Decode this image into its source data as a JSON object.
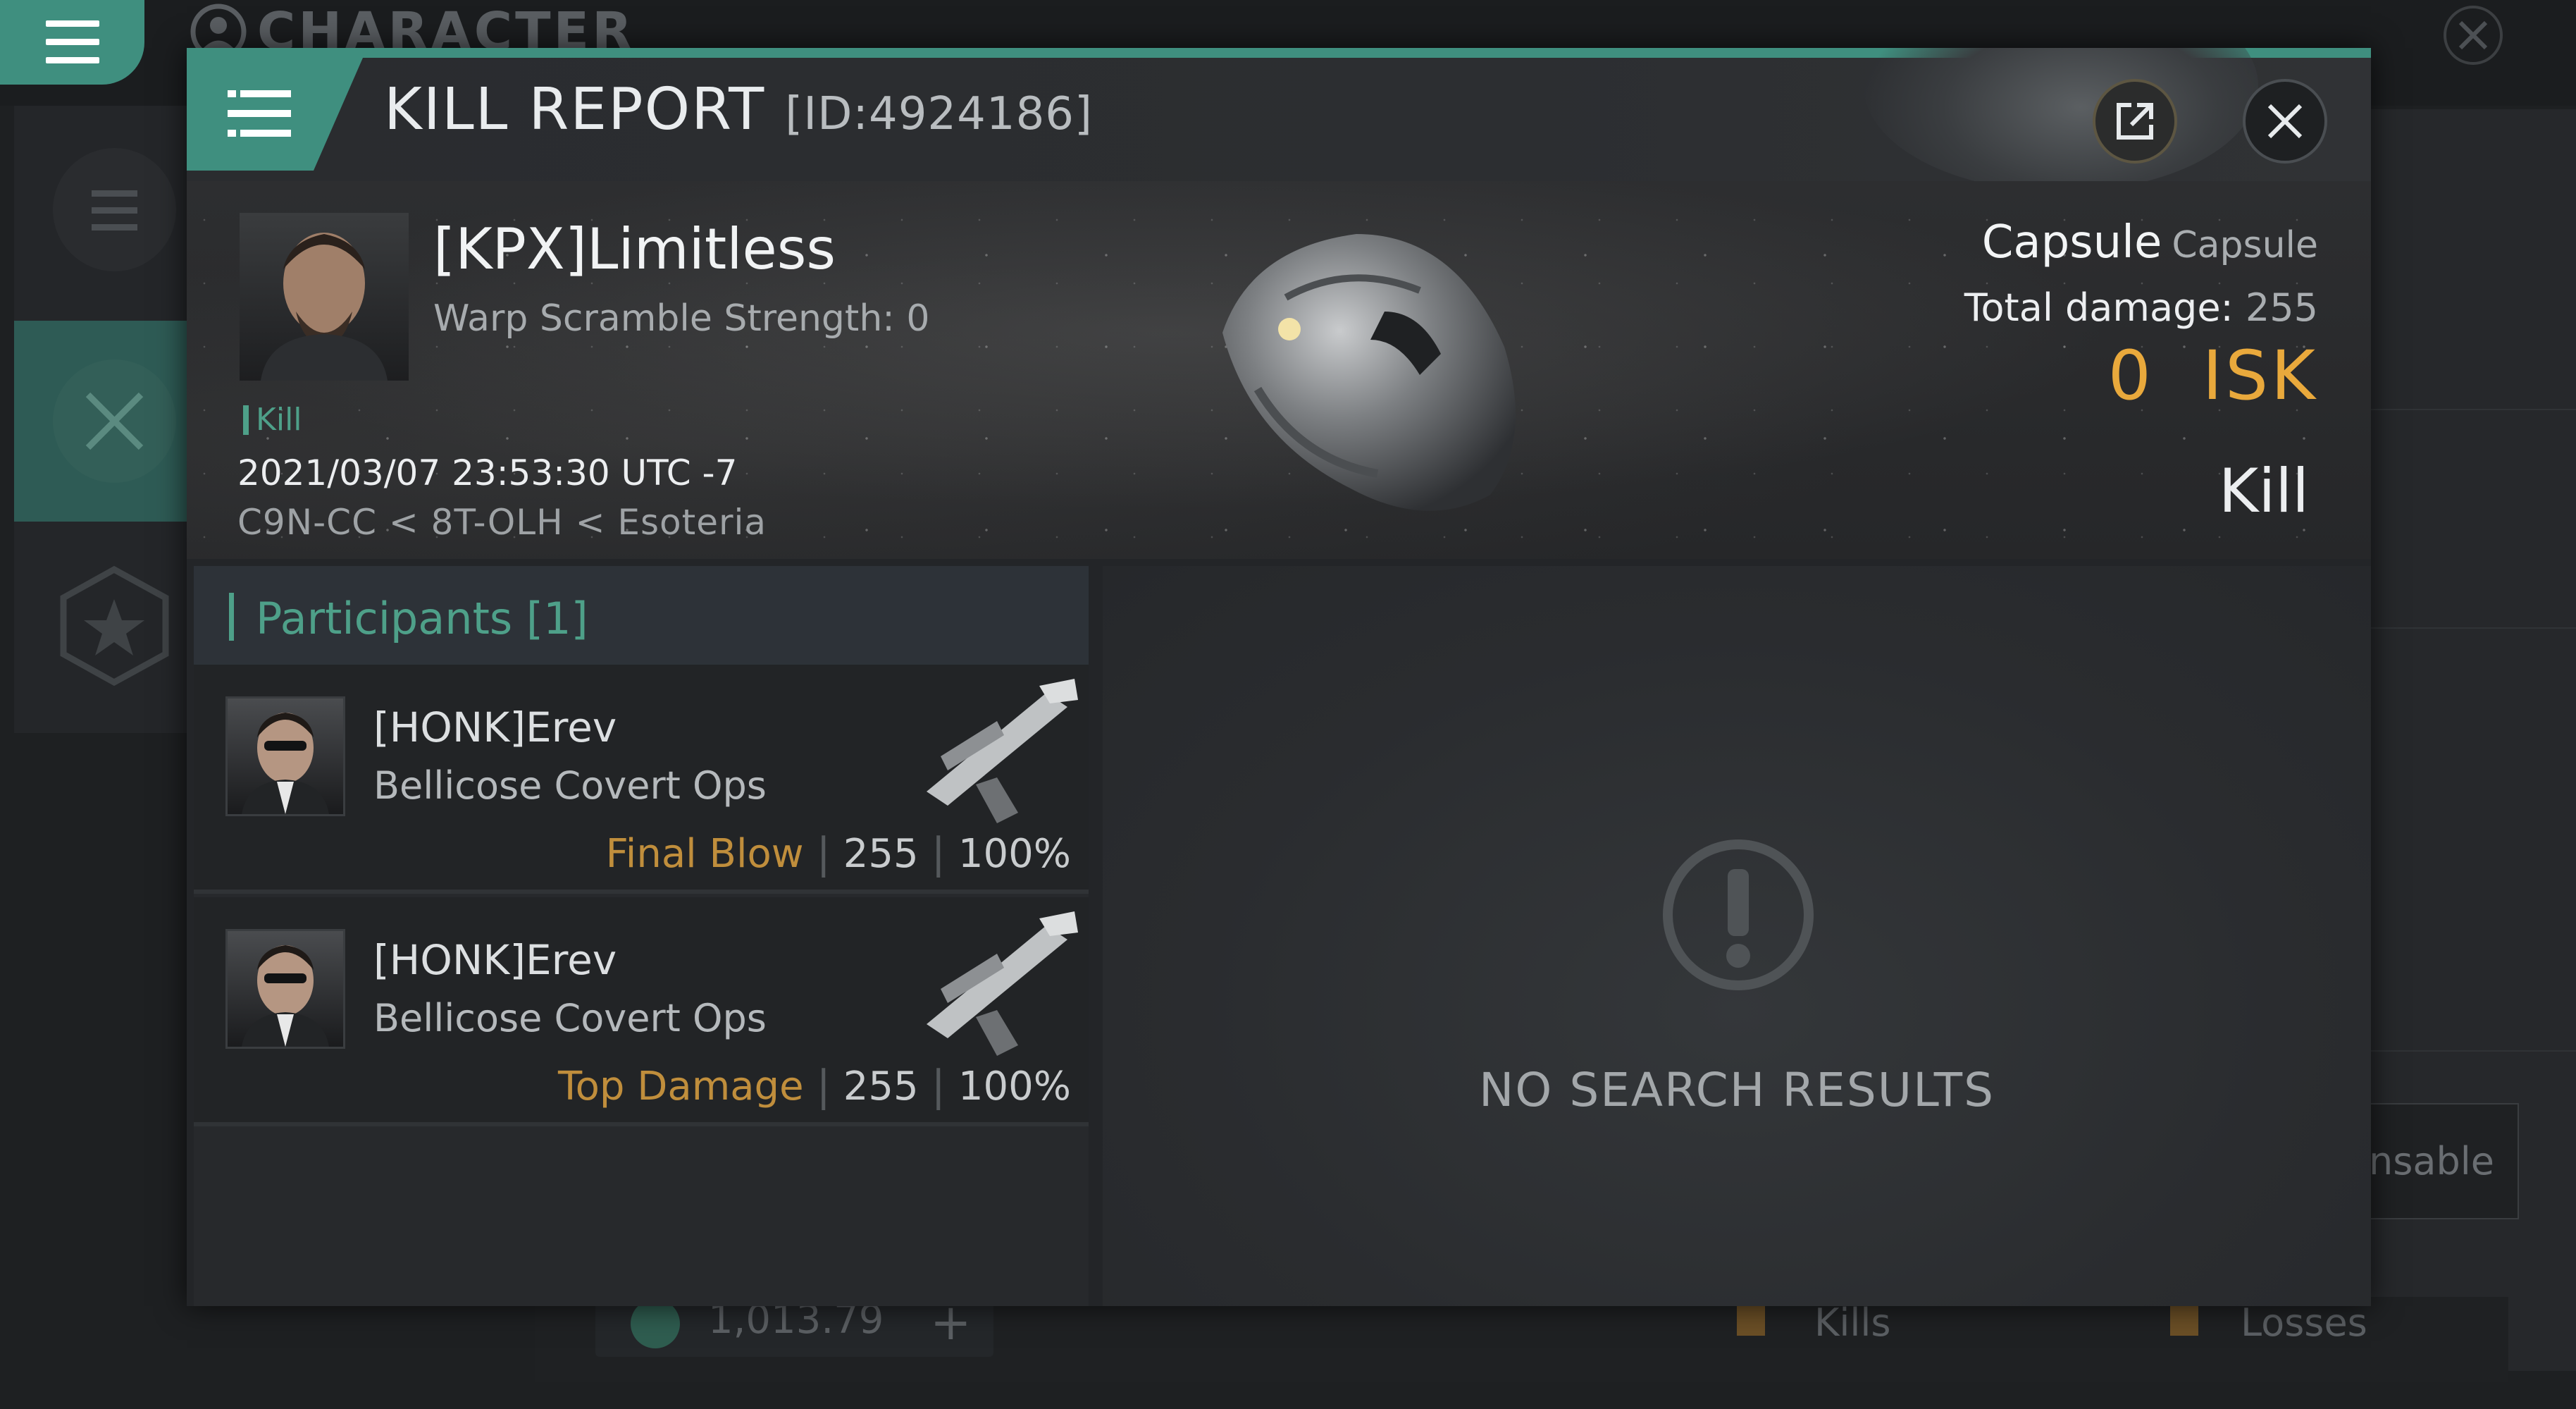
{
  "background": {
    "title": "CHARACTER",
    "collapsable_partial": "nsable",
    "security_value": "1,013.79",
    "legend": {
      "kills": "Kills",
      "losses": "Losses"
    },
    "icons": [
      "menu-icon",
      "character-icon",
      "close-icon",
      "list-icon",
      "crossed-swords-icon",
      "star-badge-icon",
      "plus-icon"
    ]
  },
  "header": {
    "title": "KILL REPORT",
    "id_text": "[ID:4924186]"
  },
  "victim": {
    "name": "[KPX]Limitless",
    "warp_scramble": "Warp Scramble Strength: 0",
    "tag": "Kill",
    "timestamp": "2021/03/07 23:53:30 UTC -7",
    "location": "C9N-CC < 8T-OLH < Esoteria",
    "ship_name": "Capsule",
    "ship_class": "Capsule",
    "total_damage_label": "Total damage:",
    "total_damage_value": "255",
    "isk": "0  ISK",
    "result": "Kill"
  },
  "participants": {
    "header": "Participants [1]",
    "rows": [
      {
        "name": "[HONK]Erev",
        "ship": "Bellicose Covert Ops",
        "label": "Final Blow",
        "damage": "255",
        "percent": "100%"
      },
      {
        "name": "[HONK]Erev",
        "ship": "Bellicose Covert Ops",
        "label": "Top Damage",
        "damage": "255",
        "percent": "100%"
      }
    ]
  },
  "results": {
    "empty_text": "NO SEARCH RESULTS"
  },
  "colors": {
    "accent_teal": "#3f8f7f",
    "isk_gold": "#e9a93c",
    "label_gold": "#c08e3c"
  }
}
